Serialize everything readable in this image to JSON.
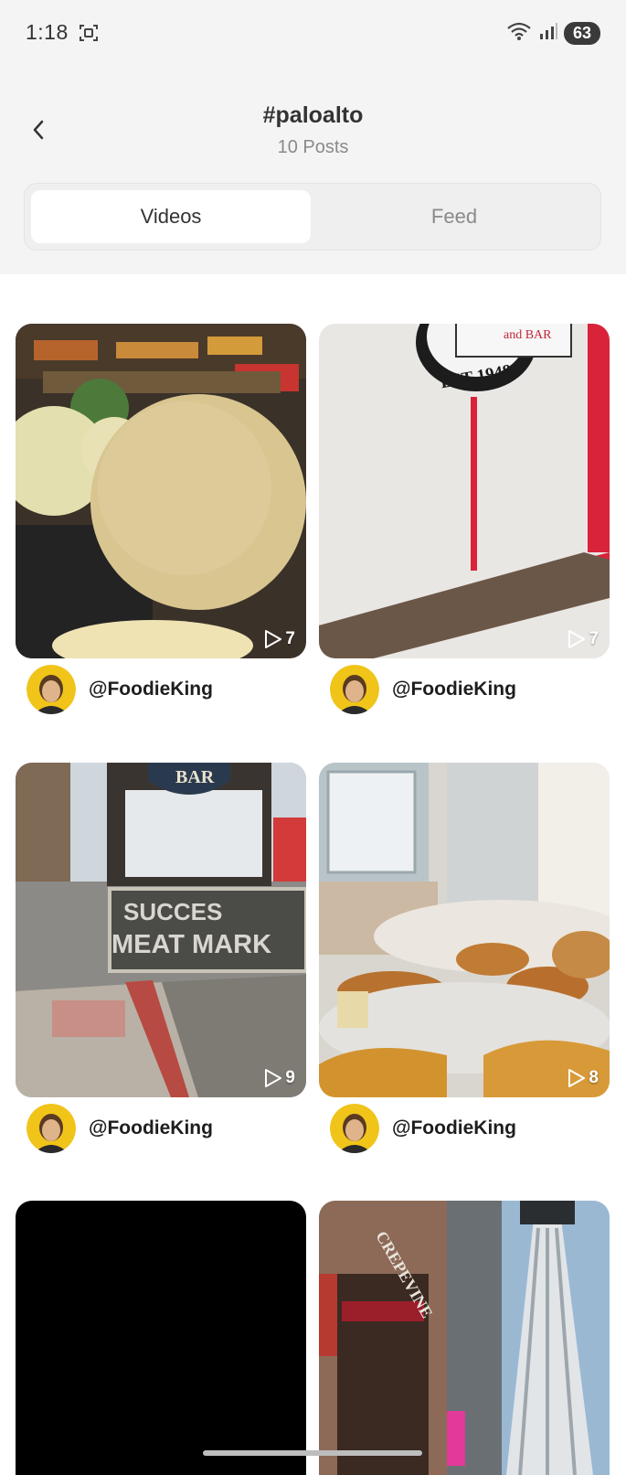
{
  "status_bar": {
    "time": "1:18",
    "battery": "63",
    "icons": [
      "screenshot-icon",
      "wifi-icon",
      "signal-icon",
      "battery-icon"
    ]
  },
  "header": {
    "back_icon": "chevron-left-icon",
    "title": "#paloalto",
    "subtitle": "10 Posts"
  },
  "tabs": [
    {
      "label": "Videos",
      "active": true
    },
    {
      "label": "Feed",
      "active": false
    }
  ],
  "colors": {
    "background": "#ffffff",
    "header_background": "#f4f4f4",
    "avatar_ring": "#f0c419",
    "tab_active": "#ffffff"
  },
  "videos": [
    {
      "author": "@FoodieKing",
      "plays": "7",
      "sign_text": ""
    },
    {
      "author": "@FoodieKing",
      "plays": "7",
      "sign_text": "EST 1948 · and BAR"
    },
    {
      "author": "@FoodieKing",
      "plays": "9",
      "sign_text": "SUCCES MEAT MARK · BAR"
    },
    {
      "author": "@FoodieKing",
      "plays": "8",
      "sign_text": ""
    },
    {
      "author": "",
      "plays": "",
      "sign_text": ""
    },
    {
      "author": "",
      "plays": "",
      "sign_text": "CREPEVINE"
    }
  ]
}
